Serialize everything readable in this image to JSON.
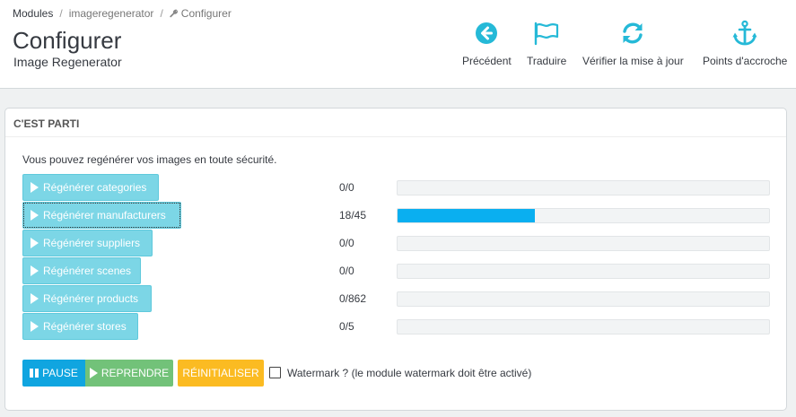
{
  "breadcrumb": {
    "items": [
      "Modules",
      "imageregenerator",
      "Configurer"
    ],
    "separator": "/"
  },
  "header": {
    "title": "Configurer",
    "subtitle": "Image Regenerator"
  },
  "toolbar": {
    "buttons": [
      {
        "label": "Précédent",
        "icon": "arrow-circle-left-icon"
      },
      {
        "label": "Traduire",
        "icon": "flag-icon"
      },
      {
        "label": "Vérifier la mise à jour",
        "icon": "refresh-icon"
      },
      {
        "label": "Points d'accroche",
        "icon": "anchor-icon"
      }
    ],
    "icon_color": "#25b9d7"
  },
  "panel": {
    "heading": "C'EST PARTI",
    "intro": "Vous pouvez regénérer vos images en toute sécurité.",
    "rows": [
      {
        "label": "Régénérer categories",
        "count": "0/0",
        "progress": 0
      },
      {
        "label": "Régénérer manufacturers",
        "count": "18/45",
        "progress": 0.37
      },
      {
        "label": "Régénérer suppliers",
        "count": "0/0",
        "progress": 0
      },
      {
        "label": "Régénérer scenes",
        "count": "0/0",
        "progress": 0
      },
      {
        "label": "Régénérer products",
        "count": "0/862",
        "progress": 0
      },
      {
        "label": "Régénérer stores",
        "count": "0/5",
        "progress": 0
      }
    ],
    "controls": {
      "pause_label": "PAUSE",
      "resume_label": "REPRENDRE",
      "reset_label": "RÉINITIALISER",
      "watermark_label": "Watermark ? (le module watermark doit être activé)",
      "watermark_checked": false
    }
  },
  "colors": {
    "regen_button": "#7cd6e6",
    "progress_fill": "#0aaff0",
    "pause": "#10a5e0",
    "resume": "#72c279",
    "reset": "#fbbb22"
  }
}
